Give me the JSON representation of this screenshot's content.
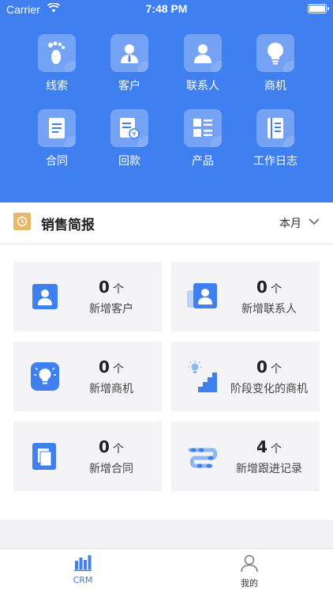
{
  "status_bar": {
    "carrier": "Carrier",
    "time": "7:48 PM"
  },
  "menu": [
    {
      "label": "线索",
      "icon": "footprint-icon"
    },
    {
      "label": "客户",
      "icon": "customer-icon"
    },
    {
      "label": "联系人",
      "icon": "contact-icon"
    },
    {
      "label": "商机",
      "icon": "lightbulb-icon"
    },
    {
      "label": "合同",
      "icon": "contract-icon"
    },
    {
      "label": "回款",
      "icon": "payment-icon"
    },
    {
      "label": "产品",
      "icon": "product-icon"
    },
    {
      "label": "工作日志",
      "icon": "worklog-icon"
    }
  ],
  "report": {
    "title": "销售简报",
    "period": "本月"
  },
  "stats": [
    {
      "value": "0",
      "unit": "个",
      "label": "新增客户",
      "icon": "customer-card-icon"
    },
    {
      "value": "0",
      "unit": "个",
      "label": "新增联系人",
      "icon": "contact-card-icon"
    },
    {
      "value": "0",
      "unit": "个",
      "label": "新增商机",
      "icon": "opportunity-icon"
    },
    {
      "value": "0",
      "unit": "个",
      "label": "阶段变化的商机",
      "icon": "stage-stairs-icon"
    },
    {
      "value": "0",
      "unit": "个",
      "label": "新增合同",
      "icon": "contract-card-icon"
    },
    {
      "value": "4",
      "unit": "个",
      "label": "新增跟进记录",
      "icon": "followup-footprint-icon"
    }
  ],
  "tabbar": {
    "crm_label": "CRM",
    "mine_label": "我的"
  },
  "colors": {
    "primary": "#3f7ff0",
    "accent": "#e8b76a",
    "card_bg": "#f4f4f6"
  }
}
